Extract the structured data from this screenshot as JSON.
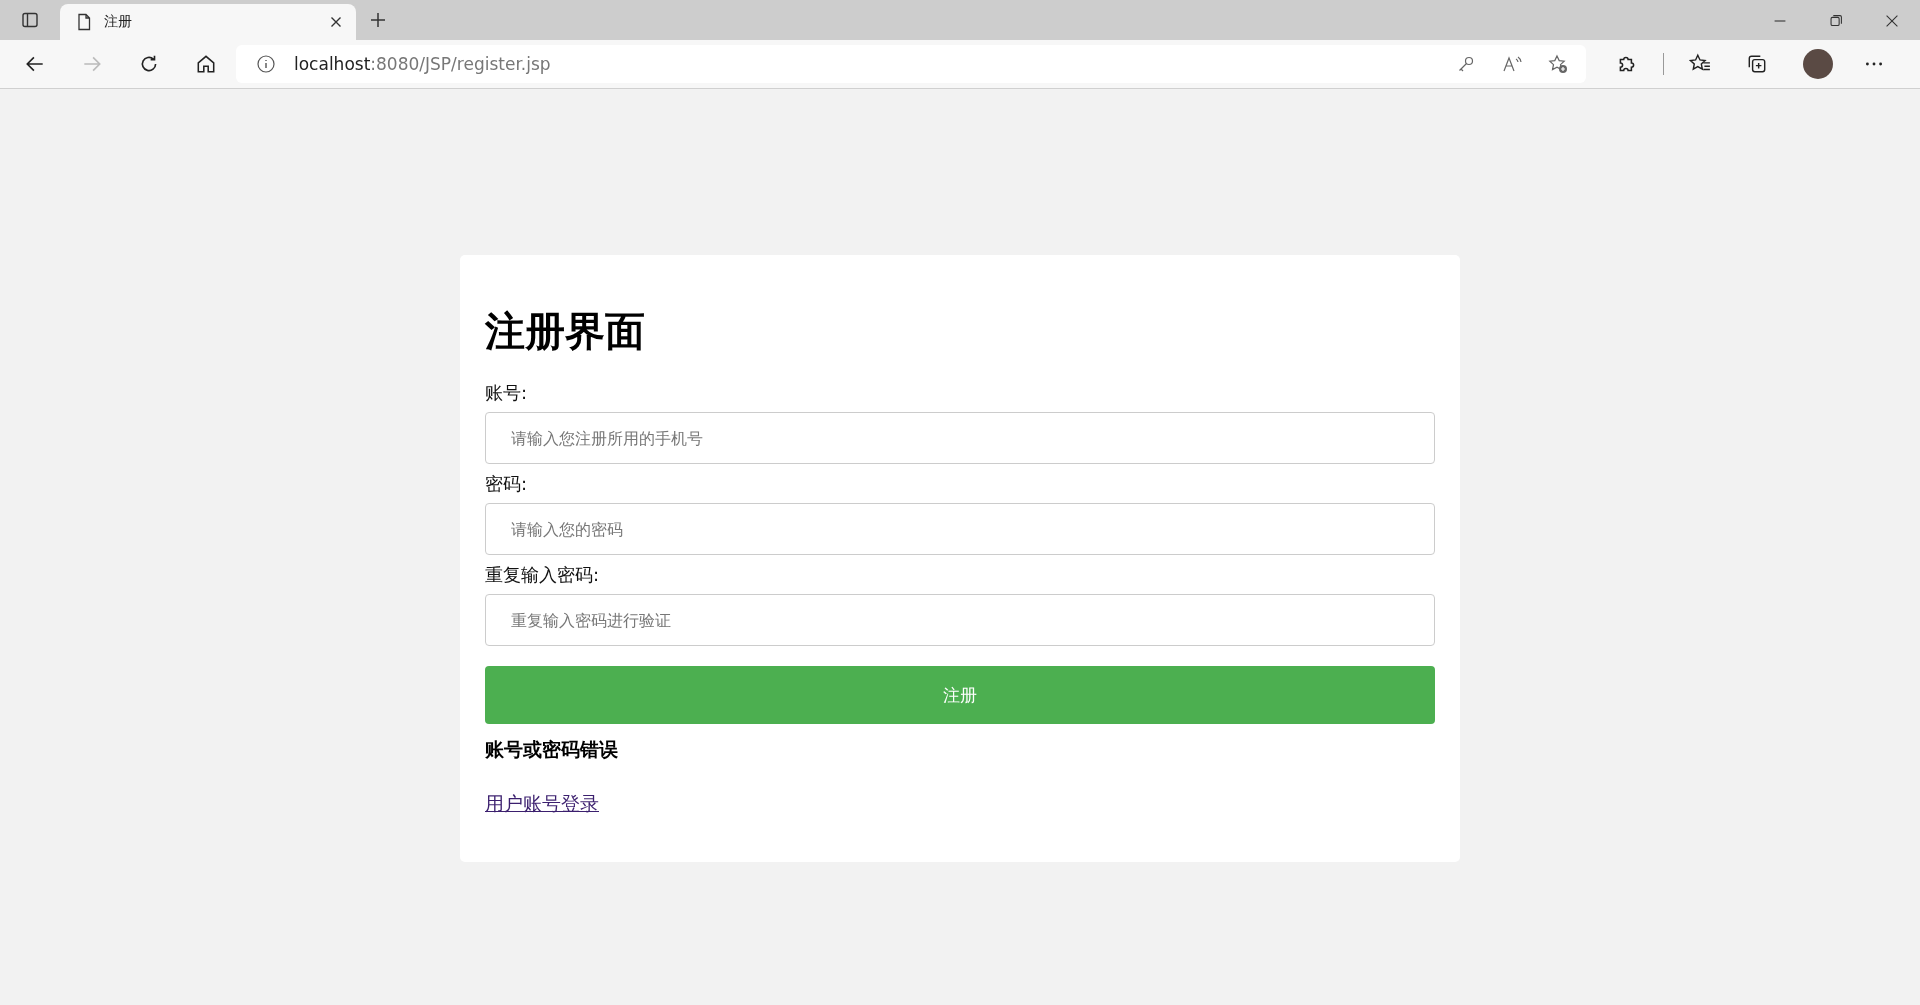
{
  "browser": {
    "tab_title": "注册",
    "url_host": "localhost",
    "url_path": ":8080/JSP/register.jsp"
  },
  "form": {
    "title": "注册界面",
    "fields": [
      {
        "label": "账号:",
        "placeholder": "请输入您注册所用的手机号"
      },
      {
        "label": "密码:",
        "placeholder": "请输入您的密码"
      },
      {
        "label": "重复输入密码:",
        "placeholder": "重复输入密码进行验证"
      }
    ],
    "submit": "注册",
    "error": "账号或密码错误",
    "link": "用户账号登录"
  }
}
